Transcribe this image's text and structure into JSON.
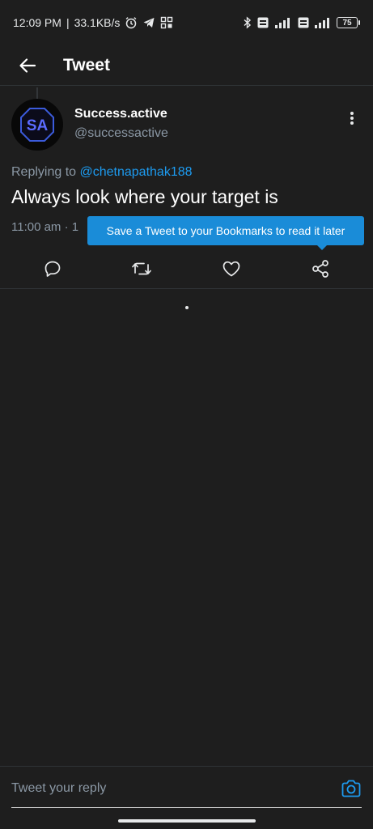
{
  "status_bar": {
    "time": "12:09 PM",
    "speed": "33.1KB/s",
    "battery": "75",
    "icons": [
      "alarm-icon",
      "telegram-icon",
      "app-grid-icon",
      "bluetooth-icon",
      "volte-icon",
      "signal-icon",
      "battery-icon"
    ]
  },
  "header": {
    "title": "Tweet"
  },
  "tweet": {
    "display_name": "Success.active",
    "handle": "@successactive",
    "avatar_text": "SA",
    "replying_prefix": "Replying to",
    "replying_to": "@chetnapathak188",
    "text": "Always look where your target is",
    "time_meta": "11:00 am · 1"
  },
  "tooltip": {
    "text": "Save a Tweet to your Bookmarks to read it later"
  },
  "actions": [
    "reply-icon",
    "retweet-icon",
    "like-icon",
    "share-icon"
  ],
  "reply_bar": {
    "placeholder": "Tweet your reply"
  },
  "colors": {
    "background": "#1e1e1e",
    "accent": "#1d9bf0",
    "tooltip": "#1a8cd8",
    "muted": "#8b98a5"
  }
}
